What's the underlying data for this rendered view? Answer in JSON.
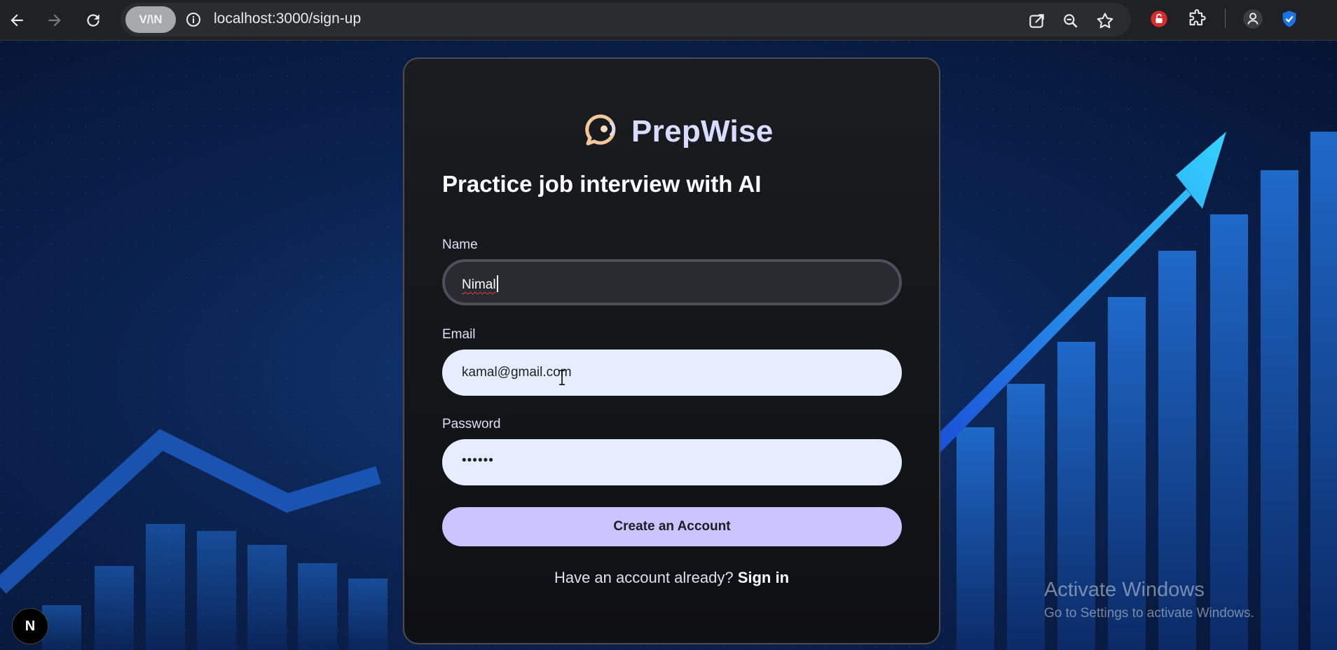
{
  "browser": {
    "url": "localhost:3000/sign-up",
    "vpn_label": "V/\\N",
    "nav": [
      "back-icon",
      "forward-icon",
      "reload-icon"
    ],
    "omnibox_icons": [
      "share-icon",
      "zoom-icon",
      "bookmark-star-icon"
    ],
    "extensions": [
      "lock-extension-icon",
      "puzzle-icon",
      "profile-icon",
      "shield-check-icon"
    ]
  },
  "card": {
    "brand": "PrepWise",
    "heading": "Practice job interview with AI",
    "fields": {
      "name": {
        "label": "Name",
        "value": "Nimal"
      },
      "email": {
        "label": "Email",
        "value": "kamal@gmail.com"
      },
      "password": {
        "label": "Password",
        "value": "••••••"
      }
    },
    "submit_label": "Create an Account",
    "footer_prompt": "Have an account already?",
    "footer_link": "Sign in"
  },
  "next_badge": "N",
  "watermark": {
    "title": "Activate Windows",
    "subtitle": "Go to Settings to activate Windows."
  },
  "colors": {
    "accent": "#cac5fe",
    "brand": "#dadcff",
    "input_light": "#e6edfe"
  }
}
